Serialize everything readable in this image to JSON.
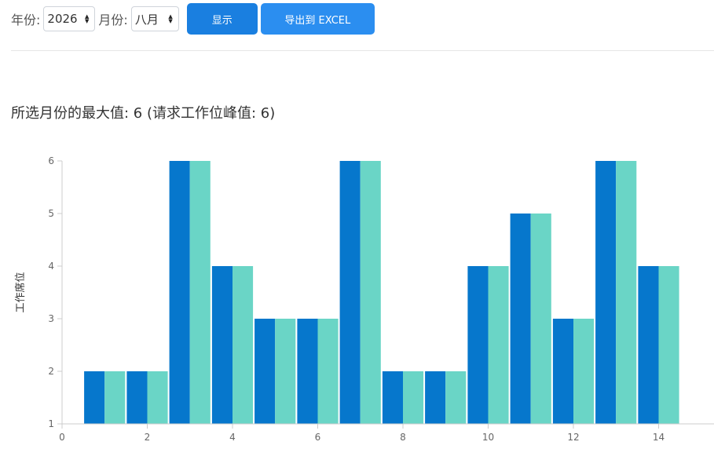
{
  "filters": {
    "year_label": "年份:",
    "year_value": "2026",
    "month_label": "月份:",
    "month_value": "八月"
  },
  "buttons": {
    "show_label": "显示",
    "export_label": "导出到 EXCEL"
  },
  "summary": {
    "headline": "所选月份的最大值: 6 (请求工作位峰值: 6)"
  },
  "colors": {
    "series_a": "#0677cc",
    "series_b": "#6ad5c6"
  },
  "chart_data": {
    "type": "bar",
    "title": "",
    "xlabel": "",
    "ylabel": "工作席位",
    "x": [
      1,
      2,
      3,
      4,
      5,
      6,
      7,
      8,
      9,
      10,
      11,
      12,
      13,
      14
    ],
    "xlim": [
      0,
      15.3
    ],
    "ylim": [
      1,
      6
    ],
    "xticks": [
      0,
      2,
      4,
      6,
      8,
      10,
      12,
      14
    ],
    "yticks": [
      1,
      2,
      3,
      4,
      5,
      6
    ],
    "grid": false,
    "series": [
      {
        "values": [
          2,
          2,
          6,
          4,
          3,
          3,
          6,
          2,
          2,
          4,
          5,
          3,
          6,
          4
        ]
      },
      {
        "values": [
          2,
          2,
          6,
          4,
          3,
          3,
          6,
          2,
          2,
          4,
          5,
          3,
          6,
          4
        ]
      }
    ]
  }
}
